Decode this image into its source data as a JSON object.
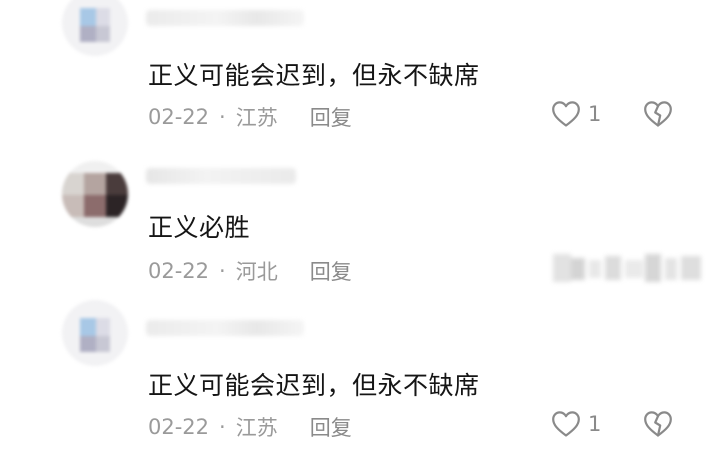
{
  "comments": [
    {
      "text": "正义可能会迟到，但永不缺席",
      "date": "02-22",
      "separator": "·",
      "location": "江苏",
      "reply_label": "回复",
      "like_count": "1"
    },
    {
      "text": "正义必胜",
      "date": "02-22",
      "separator": "·",
      "location": "河北",
      "reply_label": "回复"
    },
    {
      "text": "正义可能会迟到，但永不缺席",
      "date": "02-22",
      "separator": "·",
      "location": "江苏",
      "reply_label": "回复",
      "like_count": "1"
    }
  ],
  "icons": {
    "like": "heart-outline-icon",
    "dislike": "broken-heart-outline-icon"
  },
  "colors": {
    "text_primary": "#151515",
    "text_secondary": "#9a9a9a",
    "icon_gray": "#8a8a8a",
    "background": "#ffffff"
  }
}
